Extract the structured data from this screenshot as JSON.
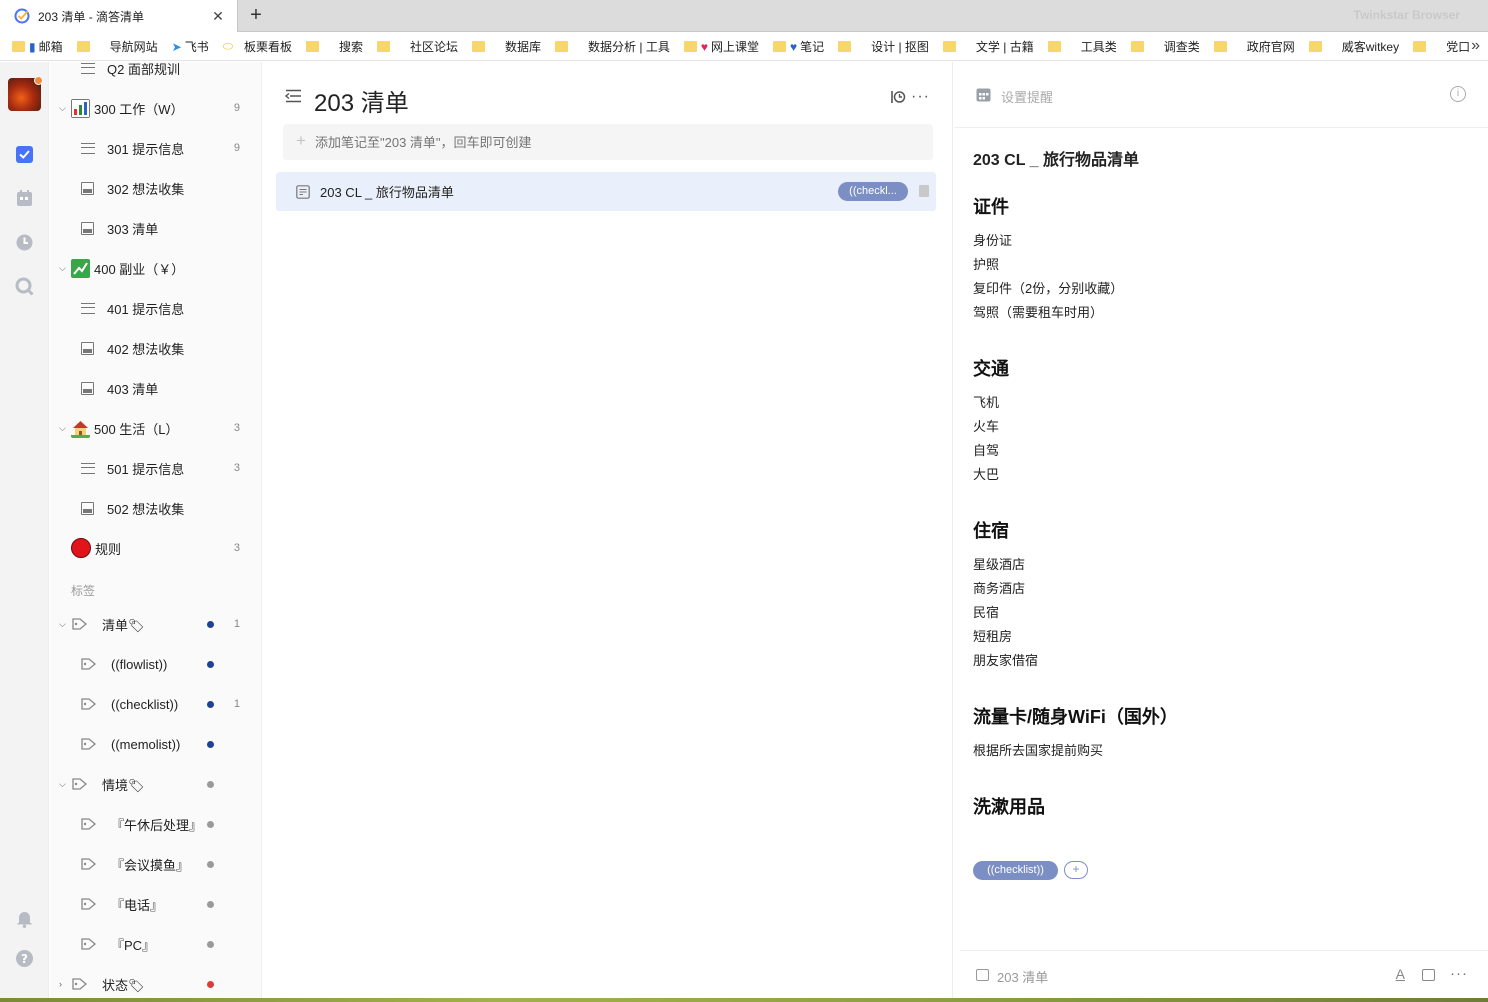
{
  "browser": {
    "tab_title": "203 清单 - 滴答清单",
    "close": "✕",
    "new_tab": "+",
    "brand": "Twinkstar Browser",
    "more": "»"
  },
  "bookmarks": [
    {
      "label": "邮箱",
      "icon": "mail-icon"
    },
    {
      "label": "导航网站",
      "icon": "folder-icon"
    },
    {
      "label": "飞书",
      "icon": "feishu-icon"
    },
    {
      "label": "板栗看板",
      "icon": "board-icon"
    },
    {
      "label": "搜索",
      "icon": "folder-icon"
    },
    {
      "label": "社区论坛",
      "icon": "folder-icon"
    },
    {
      "label": "数据库",
      "icon": "folder-icon"
    },
    {
      "label": "数据分析 | 工具",
      "icon": "folder-icon"
    },
    {
      "label": "网上课堂",
      "icon": "heart-icon"
    },
    {
      "label": "笔记",
      "icon": "heart-icon"
    },
    {
      "label": "设计 | 抠图",
      "icon": "folder-icon"
    },
    {
      "label": "文学 | 古籍",
      "icon": "folder-icon"
    },
    {
      "label": "工具类",
      "icon": "folder-icon"
    },
    {
      "label": "调查类",
      "icon": "folder-icon"
    },
    {
      "label": "政府官网",
      "icon": "folder-icon"
    },
    {
      "label": "威客witkey",
      "icon": "folder-icon"
    },
    {
      "label": "党口",
      "icon": "folder-icon"
    }
  ],
  "sidebar": {
    "partial_item": "Q2 面部规训",
    "groups": [
      {
        "label": "300 工作（W）",
        "count": "9",
        "icon": "chart-icon"
      },
      {
        "label": "400 副业（￥）",
        "icon": "growth-icon"
      },
      {
        "label": "500 生活（L）",
        "count": "3",
        "icon": "house-icon"
      }
    ],
    "items": [
      {
        "label": "301 提示信息",
        "count": "9"
      },
      {
        "label": "302 想法收集"
      },
      {
        "label": "303 清单"
      },
      {
        "label": "401 提示信息"
      },
      {
        "label": "402 想法收集"
      },
      {
        "label": "403 清单"
      },
      {
        "label": "501 提示信息",
        "count": "3"
      },
      {
        "label": "502 想法收集"
      }
    ],
    "rules": {
      "label": "规则",
      "count": "3"
    },
    "tags_section": "标签",
    "tags": [
      {
        "label": "清单🏷",
        "count": "1",
        "dot": "#1e3f9a"
      },
      {
        "label": "((flowlist))",
        "dot": "#1e3f9a"
      },
      {
        "label": "((checklist))",
        "count": "1",
        "dot": "#1e3f9a"
      },
      {
        "label": "((memolist))",
        "dot": "#1e3f9a"
      },
      {
        "label": "情境🏷",
        "dot": "#9a9a9a"
      },
      {
        "label": "『午休后处理』",
        "dot": "#9a9a9a"
      },
      {
        "label": "『会议摸鱼』",
        "dot": "#9a9a9a"
      },
      {
        "label": "『电话』",
        "dot": "#9a9a9a"
      },
      {
        "label": "『PC』",
        "dot": "#9a9a9a"
      },
      {
        "label": "状态🏷",
        "dot": "#e03a3a"
      }
    ]
  },
  "list": {
    "title": "203 清单",
    "more": "···",
    "add_placeholder": "添加笔记至\"203 清单\"，回车即可创建",
    "task": {
      "title": "203 CL _ 旅行物品清单",
      "tag": "((checkl..."
    }
  },
  "detail": {
    "reminder": "设置提醒",
    "info": "i",
    "title": "203 CL _ 旅行物品清单",
    "sections": [
      {
        "heading": "证件",
        "items": [
          "身份证",
          "护照",
          "复印件（2份，分别收藏）",
          "驾照（需要租车时用）"
        ]
      },
      {
        "heading": "交通",
        "items": [
          "飞机",
          "火车",
          "自驾",
          "大巴"
        ]
      },
      {
        "heading": "住宿",
        "items": [
          "星级酒店",
          "商务酒店",
          "民宿",
          "短租房",
          "朋友家借宿"
        ]
      },
      {
        "heading": "流量卡/随身WiFi（国外）",
        "items": [
          "根据所去国家提前购买"
        ]
      },
      {
        "heading": "洗漱用品",
        "items": []
      }
    ],
    "tag": "((checklist))",
    "add_tag": "+",
    "footer_list": "203 清单",
    "footer_font": "A",
    "footer_more": "···"
  },
  "colors": {
    "accent": "#4772fa",
    "tag_bg": "#7b8fc4",
    "selected_row": "#eaf0fb"
  }
}
